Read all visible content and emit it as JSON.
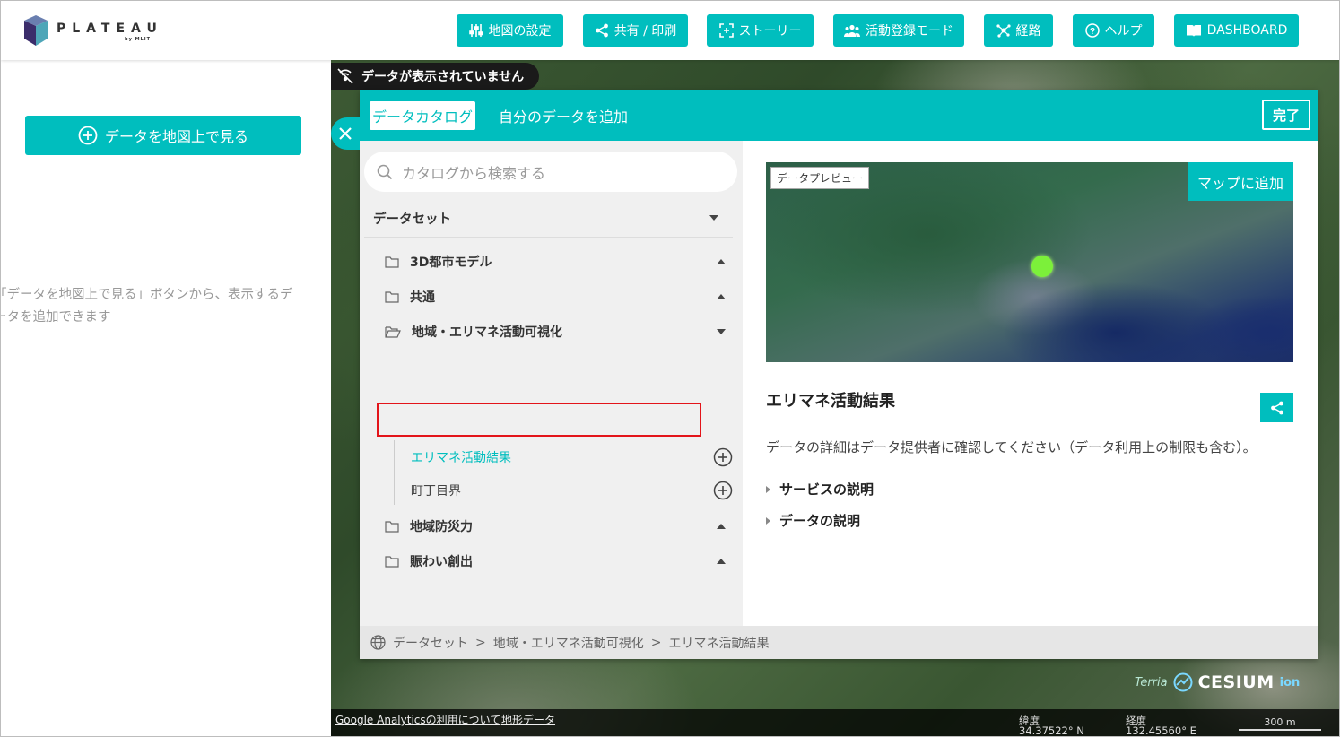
{
  "brand": {
    "name": "PLATEAU",
    "sub": "by MLIT"
  },
  "header_buttons": [
    {
      "label": "地図の設定",
      "icon": "sliders-icon"
    },
    {
      "label": "共有 / 印刷",
      "icon": "share-icon"
    },
    {
      "label": "ストーリー",
      "icon": "story-frame-icon"
    },
    {
      "label": "活動登録モード",
      "icon": "people-icon"
    },
    {
      "label": "経路",
      "icon": "route-icon"
    },
    {
      "label": "ヘルプ",
      "icon": "help-icon"
    },
    {
      "label": "DASHBOARD",
      "icon": "book-icon"
    }
  ],
  "left_panel": {
    "add_button": "データを地図上で見る",
    "hint_line1": "「データを地図上で見る」ボタンから、表示するデ",
    "hint_line2": "ータを追加できます"
  },
  "map": {
    "no_data_text": "データが表示されていません",
    "ga_link": "Google Analyticsの利用について",
    "terrain_link": "地形データ",
    "lat_label": "緯度",
    "lat_value": "34.37522° N",
    "lon_label": "経度",
    "lon_value": "132.45560° E",
    "scale": "300 m",
    "terrain_logo": "Terria",
    "cesium_logo": "CESIUM",
    "ion_logo": "ion"
  },
  "catalog": {
    "tab_catalog": "データカタログ",
    "tab_mydata": "自分のデータを追加",
    "done_button": "完了",
    "search_placeholder": "カタログから検索する",
    "dataset_header": "データセット",
    "tree": [
      {
        "label": "3D都市モデル",
        "type": "folder",
        "expanded": false
      },
      {
        "label": "共通",
        "type": "folder",
        "expanded": false
      },
      {
        "label": "地域・エリマネ活動可視化",
        "type": "folder",
        "expanded": true
      },
      {
        "label": "エリマネ活動結果",
        "type": "item",
        "selected": true
      },
      {
        "label": "町丁目界",
        "type": "item",
        "selected": false
      },
      {
        "label": "地域防災力",
        "type": "folder",
        "expanded": false
      },
      {
        "label": "賑わい創出",
        "type": "folder",
        "expanded": false
      }
    ],
    "preview_label": "データプレビュー",
    "add_to_map": "マップに追加",
    "detail_title": "エリマネ活動結果",
    "detail_note": "データの詳細はデータ提供者に確認してください（データ利用上の制限も含む）。",
    "expanders": [
      "サービスの説明",
      "データの説明"
    ],
    "breadcrumb": [
      "データセット",
      "地域・エリマネ活動可視化",
      "エリマネ活動結果"
    ],
    "breadcrumb_sep": ">"
  },
  "colors": {
    "accent": "#00bebe",
    "highlight": "#e3141a",
    "preview_dot": "#7cf03a"
  }
}
